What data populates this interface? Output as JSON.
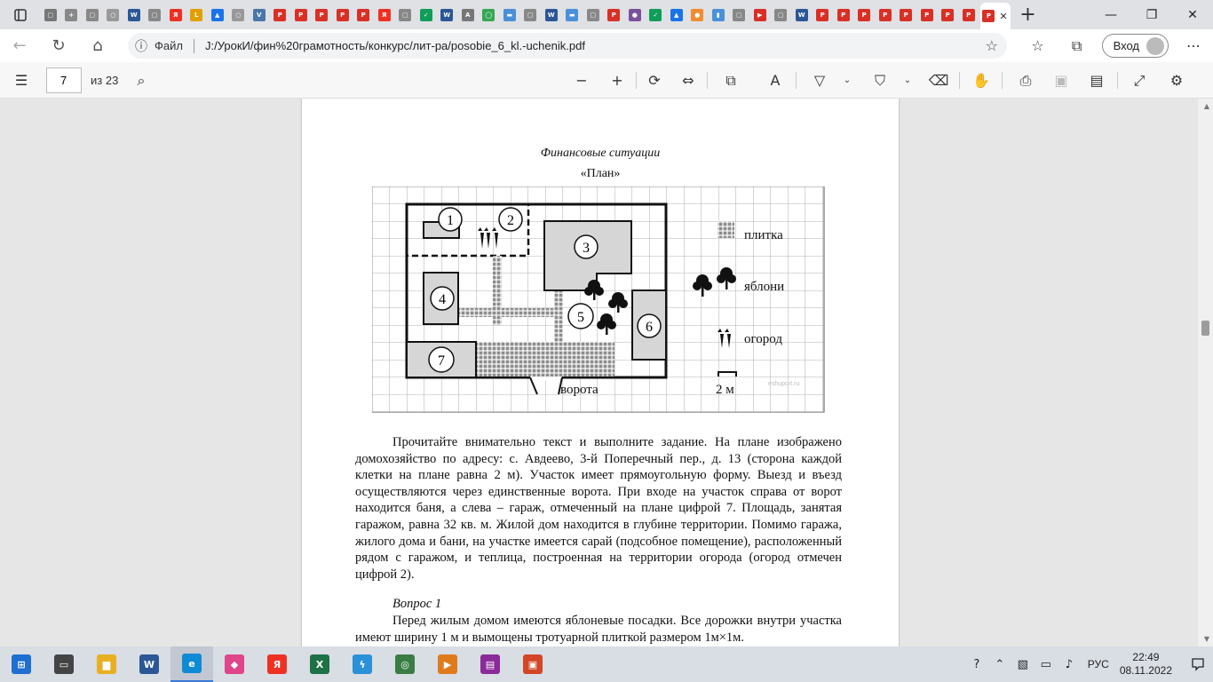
{
  "browser": {
    "tabs": [
      {
        "icon": "doc-icon",
        "color": "#777",
        "glyph": "▢"
      },
      {
        "icon": "plus-icon",
        "color": "#888",
        "glyph": "+"
      },
      {
        "icon": "doc-icon",
        "color": "#888",
        "glyph": "▢"
      },
      {
        "icon": "search-icon",
        "color": "#999",
        "glyph": "○"
      },
      {
        "icon": "w-icon",
        "color": "#2b5797",
        "glyph": "W"
      },
      {
        "icon": "doc-icon",
        "color": "#888",
        "glyph": "▢"
      },
      {
        "icon": "yandex-icon",
        "color": "#ef3124",
        "glyph": "Я"
      },
      {
        "icon": "l-icon",
        "color": "#e0a000",
        "glyph": "L"
      },
      {
        "icon": "drive-icon",
        "color": "#1a73e8",
        "glyph": "▲"
      },
      {
        "icon": "search-icon",
        "color": "#999",
        "glyph": "○"
      },
      {
        "icon": "vk-icon",
        "color": "#4a76a8",
        "glyph": "V"
      },
      {
        "icon": "pdf-icon",
        "color": "#d93025",
        "glyph": "P"
      },
      {
        "icon": "pdf-icon",
        "color": "#d93025",
        "glyph": "P"
      },
      {
        "icon": "pdf-icon",
        "color": "#d93025",
        "glyph": "P"
      },
      {
        "icon": "pdf-icon",
        "color": "#d93025",
        "glyph": "P"
      },
      {
        "icon": "pdf-icon",
        "color": "#d93025",
        "glyph": "P"
      },
      {
        "icon": "yandex-icon",
        "color": "#ef3124",
        "glyph": "Я"
      },
      {
        "icon": "doc-icon",
        "color": "#888",
        "glyph": "▢"
      },
      {
        "icon": "vote-icon",
        "color": "#0f9d58",
        "glyph": "✓"
      },
      {
        "icon": "word-icon",
        "color": "#2b5797",
        "glyph": "W"
      },
      {
        "icon": "a-icon",
        "color": "#777",
        "glyph": "A"
      },
      {
        "icon": "circle-icon",
        "color": "#34a853",
        "glyph": "◯"
      },
      {
        "icon": "image-icon",
        "color": "#4a90d9",
        "glyph": "▬"
      },
      {
        "icon": "doc-icon",
        "color": "#888",
        "glyph": "▢"
      },
      {
        "icon": "word-icon",
        "color": "#2b5797",
        "glyph": "W"
      },
      {
        "icon": "image-icon",
        "color": "#4a90d9",
        "glyph": "▬"
      },
      {
        "icon": "doc-icon",
        "color": "#888",
        "glyph": "▢"
      },
      {
        "icon": "pdf-icon",
        "color": "#d93025",
        "glyph": "P"
      },
      {
        "icon": "viber-icon",
        "color": "#7b519d",
        "glyph": "●"
      },
      {
        "icon": "check-icon",
        "color": "#0f9d58",
        "glyph": "✓"
      },
      {
        "icon": "drive-icon",
        "color": "#1a73e8",
        "glyph": "▲"
      },
      {
        "icon": "orange-icon",
        "color": "#f28b30",
        "glyph": "●"
      },
      {
        "icon": "flag-icon",
        "color": "#4a90d9",
        "glyph": "▮"
      },
      {
        "icon": "doc-icon",
        "color": "#888",
        "glyph": "▢"
      },
      {
        "icon": "youtube-icon",
        "color": "#d93025",
        "glyph": "▶"
      },
      {
        "icon": "doc-icon",
        "color": "#888",
        "glyph": "▢"
      },
      {
        "icon": "word-icon",
        "color": "#2b5797",
        "glyph": "W"
      },
      {
        "icon": "pdf-icon",
        "color": "#d93025",
        "glyph": "P"
      },
      {
        "icon": "pdf-icon",
        "color": "#d93025",
        "glyph": "P"
      },
      {
        "icon": "pdf-icon",
        "color": "#d93025",
        "glyph": "P"
      },
      {
        "icon": "pdf-icon",
        "color": "#d93025",
        "glyph": "P"
      },
      {
        "icon": "pdf-icon",
        "color": "#d93025",
        "glyph": "P"
      },
      {
        "icon": "pdf-icon",
        "color": "#d93025",
        "glyph": "P"
      },
      {
        "icon": "pdf-icon",
        "color": "#d93025",
        "glyph": "P"
      },
      {
        "icon": "pdf-icon",
        "color": "#d93025",
        "glyph": "P"
      }
    ],
    "active_tab": {
      "icon": "pdf-icon",
      "color": "#d93025",
      "glyph": "P"
    },
    "address": {
      "file_label": "Файл",
      "url": "J:/УрокИ/фин%20грамотность/конкурс/лит-ра/posobie_6_kl.-uchenik.pdf"
    },
    "signin_label": "Вход"
  },
  "pdf_toolbar": {
    "page_current": "7",
    "page_total": "из 23"
  },
  "document": {
    "section_title": "Финансовые ситуации",
    "plan_title": "«План»",
    "plan_labels": {
      "tile": "плитка",
      "apple_trees": "яблони",
      "garden": "огород",
      "gate": "ворота",
      "scale": "2 м",
      "watermark": "eshuport.ru"
    },
    "plan_numbers": [
      "1",
      "2",
      "3",
      "4",
      "5",
      "6",
      "7"
    ],
    "paragraph": "Прочитайте внимательно текст и выполните задание. На плане изображено домохозяйство по адресу: с. Авдеево, 3-й Поперечный пер., д. 13 (сторона каждой клетки на плане равна 2 м). Участок имеет прямоугольную форму. Выезд и въезд осуществляются через единственные ворота. При входе на участок справа от ворот находится баня, а слева – гараж, отмеченный на плане цифрой 7. Площадь, занятая гаражом, равна 32 кв. м. Жилой дом находится в глубине территории. Помимо гаража, жилого дома и бани, на участке имеется сарай (подсобное помещение), расположенный рядом с гаражом, и теплица, построенная на территории огорода (огород отмечен цифрой 2).",
    "question_title": "Вопрос 1",
    "question_text": "Перед жилым домом имеются яблоневые посадки. Все дорожки внутри участка имеют ширину 1 м и вымощены тротуарной плиткой размером 1м×1м."
  },
  "taskbar": {
    "apps": [
      {
        "name": "windows-start-icon",
        "color": "#1f6fd1",
        "glyph": "⊞"
      },
      {
        "name": "task-view-icon",
        "color": "#444",
        "glyph": "▭"
      },
      {
        "name": "file-explorer-icon",
        "color": "#e8b021",
        "glyph": "▆"
      },
      {
        "name": "word-app-icon",
        "color": "#2b5797",
        "glyph": "W"
      },
      {
        "name": "edge-app-icon",
        "color": "#0f8ad4",
        "glyph": "e"
      },
      {
        "name": "paint-drop-icon",
        "color": "#e0458a",
        "glyph": "◆"
      },
      {
        "name": "yandex-app-icon",
        "color": "#ef3124",
        "glyph": "Я"
      },
      {
        "name": "excel-app-icon",
        "color": "#1e7145",
        "glyph": "X"
      },
      {
        "name": "lightning-app-icon",
        "color": "#2a91d8",
        "glyph": "ϟ"
      },
      {
        "name": "globe-app-icon",
        "color": "#3a7d44",
        "glyph": "◎"
      },
      {
        "name": "video-app-icon",
        "color": "#e07b1c",
        "glyph": "▶"
      },
      {
        "name": "winrar-app-icon",
        "color": "#8b2a9a",
        "glyph": "▤"
      },
      {
        "name": "presentation-app-icon",
        "color": "#d24726",
        "glyph": "▣"
      }
    ],
    "language": "РУС",
    "time": "22:49",
    "date": "08.11.2022"
  }
}
